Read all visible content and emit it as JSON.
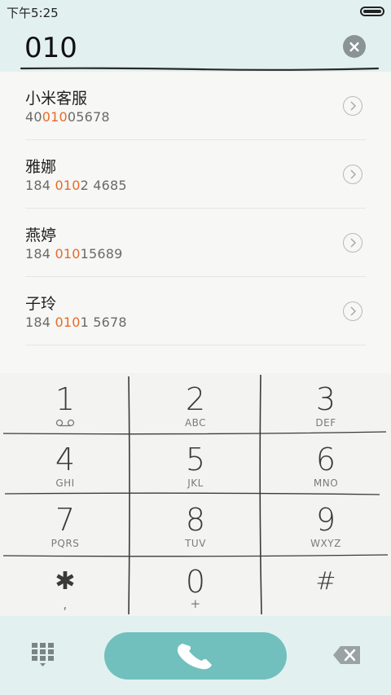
{
  "status_bar": {
    "time": "下午5:25",
    "battery_icon": "battery-full-icon"
  },
  "dial_input": {
    "value": "010",
    "clear_icon": "clear-icon"
  },
  "results": [
    {
      "name": "小米客服",
      "number_pre": "40",
      "number_match": "010",
      "number_post": "05678"
    },
    {
      "name": "雅娜",
      "number_pre": "184 ",
      "number_match": "010",
      "number_post": "2 4685"
    },
    {
      "name": "燕婷",
      "number_pre": "184 ",
      "number_match": "010",
      "number_post": "15689"
    },
    {
      "name": "子玲",
      "number_pre": "184 ",
      "number_match": "010",
      "number_post": "1 5678"
    }
  ],
  "keypad": [
    {
      "digit": "1",
      "letters": "",
      "icon": "voicemail-icon"
    },
    {
      "digit": "2",
      "letters": "ABC"
    },
    {
      "digit": "3",
      "letters": "DEF"
    },
    {
      "digit": "4",
      "letters": "GHI"
    },
    {
      "digit": "5",
      "letters": "JKL"
    },
    {
      "digit": "6",
      "letters": "MNO"
    },
    {
      "digit": "7",
      "letters": "PQRS"
    },
    {
      "digit": "8",
      "letters": "TUV"
    },
    {
      "digit": "9",
      "letters": "WXYZ"
    },
    {
      "digit": "✱",
      "letters": ","
    },
    {
      "digit": "0",
      "letters": "+"
    },
    {
      "digit": "#",
      "letters": ""
    }
  ],
  "action_bar": {
    "keypad_toggle_icon": "dialpad-grid-icon",
    "call_icon": "phone-icon",
    "backspace_icon": "backspace-icon"
  },
  "colors": {
    "accent_teal": "#71c0bd",
    "header_bg": "#e2f1f0",
    "match_highlight": "#e86a2a"
  }
}
